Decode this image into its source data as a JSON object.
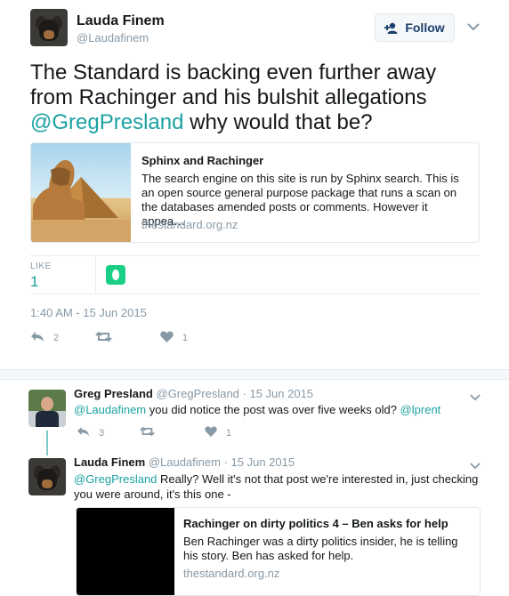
{
  "main_tweet": {
    "author_name": "Lauda Finem",
    "author_handle": "@Laudafinem",
    "follow_label": "Follow",
    "text_before": "The Standard is backing even further away from Rachinger and his bulshit allegations ",
    "mention": "@GregPresland",
    "text_after": " why would that be?",
    "card": {
      "title": "Sphinx and Rachinger",
      "description": "The search engine on this site is run by Sphinx search. This is an open source general purpose package that runs a scan on the databases amended posts or comments. However it appea…",
      "url": "thestandard.org.nz"
    },
    "like_label": "LIKE",
    "like_count": "1",
    "timestamp": "1:40 AM - 15 Jun 2015",
    "actions": {
      "reply_count": "2",
      "retweet_count": "",
      "like_count": "1"
    }
  },
  "replies": [
    {
      "author_name": "Greg Presland",
      "author_handle": "@GregPresland",
      "date": "· 15 Jun 2015",
      "mention1": "@Laudafinem",
      "text": " you did notice the post was over five weeks old? ",
      "mention2": "@lprent",
      "actions": {
        "reply_count": "3",
        "retweet_count": "",
        "like_count": "1"
      }
    },
    {
      "author_name": "Lauda Finem",
      "author_handle": "@Laudafinem",
      "date": "· 15 Jun 2015",
      "mention1": "@GregPresland",
      "text_line1": " Really? Well it's not that post we're interested in, just checking",
      "text_line2": "you were around, it's this one -",
      "card": {
        "title": "Rachinger on dirty politics 4 – Ben asks for help",
        "description": "Ben Rachinger was a dirty politics insider, he is telling his story. Ben has asked for help.",
        "url": "thestandard.org.nz"
      }
    }
  ],
  "icons": [
    "add-user-icon",
    "chevron-down-icon",
    "reply-icon",
    "retweet-icon",
    "heart-icon",
    "liker-avatar-icon"
  ],
  "colors": {
    "link": "#1da1a1",
    "muted": "#8899a6",
    "follow_text": "#1a3e6e",
    "liker_badge": "#19cf86"
  }
}
